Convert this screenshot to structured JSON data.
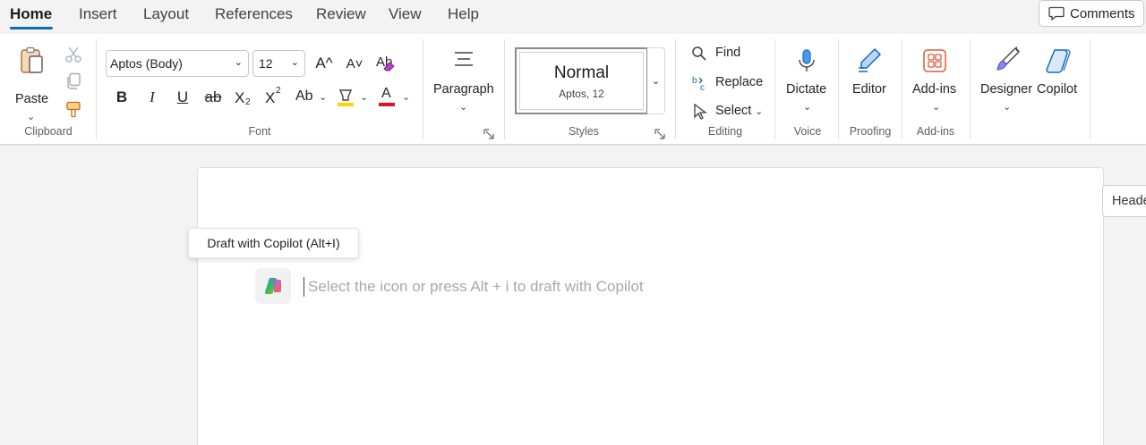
{
  "menu": {
    "tabs": [
      {
        "label": "Home",
        "active": true
      },
      {
        "label": "Insert"
      },
      {
        "label": "Layout"
      },
      {
        "label": "References"
      },
      {
        "label": "Review"
      },
      {
        "label": "View"
      },
      {
        "label": "Help"
      }
    ],
    "comments_label": "Comments"
  },
  "ribbon": {
    "clipboard": {
      "paste_label": "Paste",
      "group_label": "Clipboard"
    },
    "font": {
      "font_name": "Aptos (Body)",
      "font_size": "12",
      "group_label": "Font",
      "grow_label": "A^",
      "shrink_label": "A˅",
      "bold": "B",
      "italic": "I",
      "underline": "U",
      "strike": "ab",
      "subscript": "X",
      "subscript_mark": "2",
      "superscript": "X",
      "superscript_mark": "2",
      "change_case": "Ab",
      "font_color_letter": "A",
      "clear_format_letters": "Ab"
    },
    "paragraph": {
      "label": "Paragraph"
    },
    "styles": {
      "style_name": "Normal",
      "style_detail": "Aptos, 12",
      "group_label": "Styles"
    },
    "editing": {
      "find": "Find",
      "replace": "Replace",
      "select": "Select",
      "group_label": "Editing"
    },
    "voice": {
      "dictate": "Dictate",
      "group_label": "Voice"
    },
    "proofing": {
      "editor": "Editor",
      "group_label": "Proofing"
    },
    "addins": {
      "label": "Add-ins",
      "group_label": "Add-ins"
    },
    "designer": {
      "label": "Designer"
    },
    "copilot": {
      "label": "Copilot"
    }
  },
  "document": {
    "tooltip": "Draft with Copilot (Alt+I)",
    "placeholder": "Select the icon or press Alt + i to draft with Copilot",
    "side_tab": "Heade"
  },
  "colors": {
    "accent": "#0f6cbd",
    "font_color_bar": "#e81123",
    "highlight_bar": "#ffd400",
    "addins_icon": "#e05a3a"
  }
}
